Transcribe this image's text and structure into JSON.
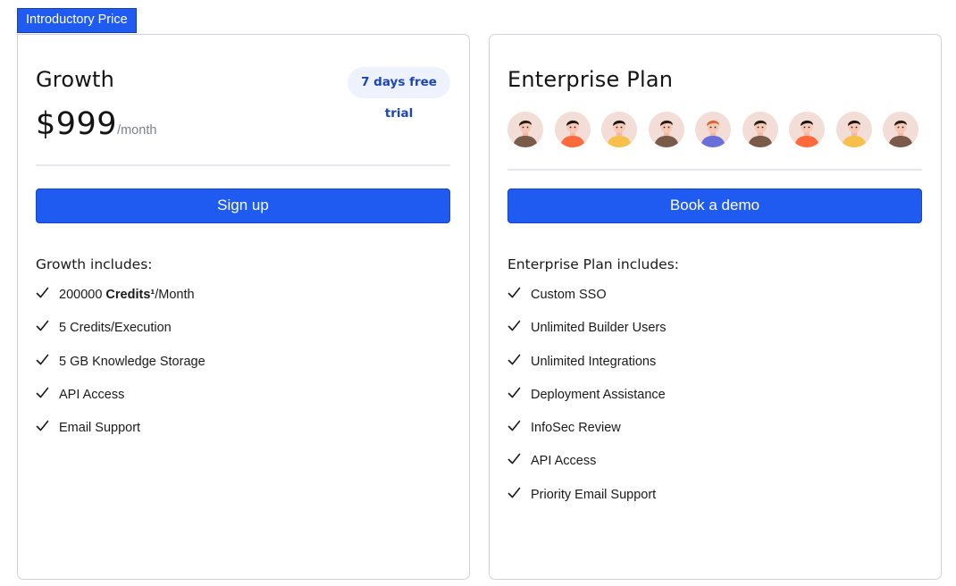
{
  "intro_badge": "Introductory Price",
  "growth": {
    "title": "Growth",
    "trial": "7 days free trial",
    "price": "$999",
    "per": "/month",
    "cta": "Sign up",
    "includes_title": "Growth includes:",
    "features": [
      {
        "pre": "200000 ",
        "bold": "Credits¹",
        "post": "/Month"
      },
      {
        "pre": "5 Credits/Execution",
        "bold": "",
        "post": ""
      },
      {
        "pre": "5 GB Knowledge Storage",
        "bold": "",
        "post": ""
      },
      {
        "pre": "API Access",
        "bold": "",
        "post": ""
      },
      {
        "pre": "Email Support",
        "bold": "",
        "post": ""
      }
    ]
  },
  "enterprise": {
    "title": "Enterprise Plan",
    "cta": "Book a demo",
    "includes_title": "Enterprise Plan includes:",
    "avatars": [
      {
        "bg": "#f3ddd7",
        "shirt": "#7a5a48",
        "hair": "#2a1c16"
      },
      {
        "bg": "#f3ddd7",
        "shirt": "#ff6a3d",
        "hair": "#1c1412"
      },
      {
        "bg": "#f3ddd7",
        "shirt": "#f6c04a",
        "hair": "#1c1412"
      },
      {
        "bg": "#f3ddd7",
        "shirt": "#7a5a48",
        "hair": "#2a1c16"
      },
      {
        "bg": "#f3ddd7",
        "shirt": "#6b6fd8",
        "hair": "#e0633a"
      },
      {
        "bg": "#f3ddd7",
        "shirt": "#7a5a48",
        "hair": "#2a1c16"
      },
      {
        "bg": "#f3ddd7",
        "shirt": "#ff6a3d",
        "hair": "#1c1412"
      },
      {
        "bg": "#f3ddd7",
        "shirt": "#f6c04a",
        "hair": "#1c1412"
      },
      {
        "bg": "#f3ddd7",
        "shirt": "#7a5a48",
        "hair": "#2a1c16"
      }
    ],
    "features": [
      "Custom SSO",
      "Unlimited Builder Users",
      "Unlimited Integrations",
      "Deployment Assistance",
      "InfoSec Review",
      "API Access",
      "Priority Email Support"
    ]
  },
  "colors": {
    "accent": "#1f5bf0",
    "pill_bg": "#eef2fc",
    "border": "#cfd3d8"
  },
  "icons": {
    "check": "check-icon",
    "avatar": "person-avatar-icon"
  }
}
